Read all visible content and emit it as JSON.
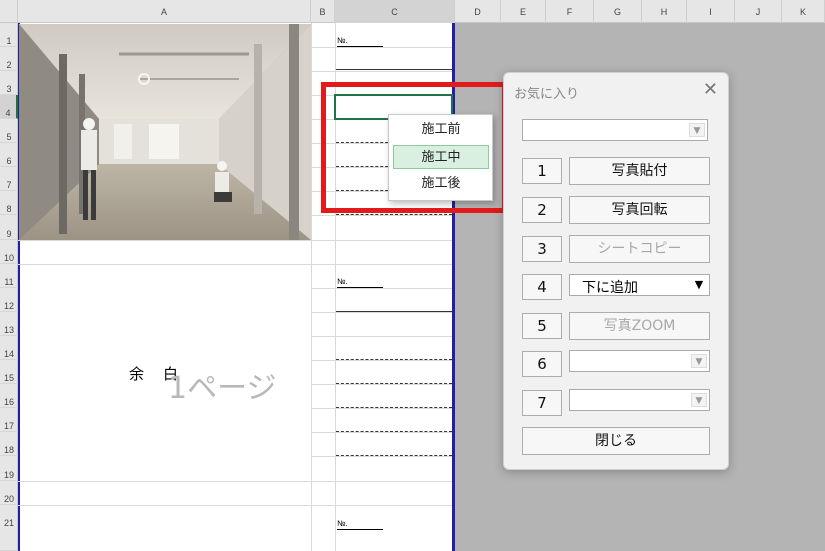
{
  "columns": [
    "A",
    "B",
    "C",
    "D",
    "E",
    "F",
    "G",
    "H",
    "I",
    "J",
    "K"
  ],
  "rows": [
    "1",
    "2",
    "3",
    "4",
    "5",
    "6",
    "7",
    "8",
    "9",
    "10",
    "11",
    "12",
    "13",
    "14",
    "15",
    "16",
    "17",
    "18",
    "19",
    "20",
    "21"
  ],
  "cells": {
    "no_label": "№.",
    "yohaku": "余　白",
    "page_watermark": "1ページ"
  },
  "dropdown_list": {
    "items": [
      "施工前",
      "施工中",
      "施工後"
    ],
    "selected": "施工中"
  },
  "dialog": {
    "title": "お気に入り",
    "close_glyph": "✕",
    "top_combo_value": "",
    "rows": [
      {
        "num": "1",
        "label": "写真貼付",
        "enabled": true
      },
      {
        "num": "2",
        "label": "写真回転",
        "enabled": true
      },
      {
        "num": "3",
        "label": "シートコピー",
        "enabled": false
      },
      {
        "num": "4",
        "combo_value": "下に追加"
      },
      {
        "num": "5",
        "label": "写真ZOOM",
        "enabled": false
      },
      {
        "num": "6",
        "combo_value": ""
      },
      {
        "num": "7",
        "combo_value": ""
      }
    ],
    "close_label": "閉じる"
  },
  "colors": {
    "selection_green": "#217346",
    "highlight_red": "#e31a1a",
    "print_border_blue": "#1f1fa8"
  }
}
